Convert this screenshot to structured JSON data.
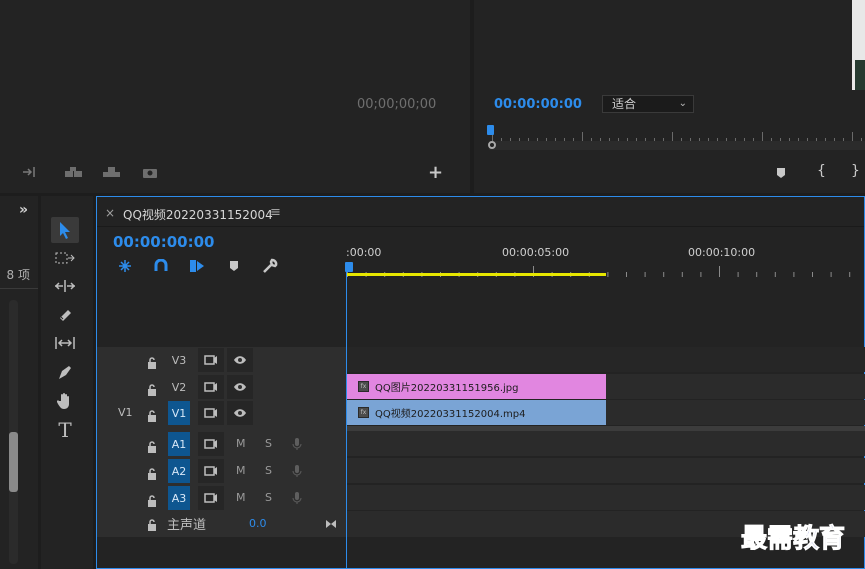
{
  "source_monitor": {
    "timecode": "00;00;00;00",
    "add_icon": "+"
  },
  "program_monitor": {
    "timecode": "00:00:00:00",
    "fit_label": "适合",
    "brace_left": "{",
    "brace_right": "}"
  },
  "project_panel": {
    "items_label": "8 项",
    "expand_icon": "»"
  },
  "timeline": {
    "close": "×",
    "sequence_name": "QQ视频20220331152004",
    "menu": "≡",
    "timecode": "00:00:00:00",
    "ruler": [
      ":00:00",
      "00:00:05:00",
      "00:00:10:00"
    ],
    "tracks": {
      "video": [
        {
          "label": "V3",
          "source": ""
        },
        {
          "label": "V2",
          "source": ""
        },
        {
          "label": "V1",
          "source": "V1"
        }
      ],
      "audio": [
        {
          "label": "A1",
          "m": "M",
          "s": "S"
        },
        {
          "label": "A2",
          "m": "M",
          "s": "S"
        },
        {
          "label": "A3",
          "m": "M",
          "s": "S"
        }
      ],
      "master_label": "主声道",
      "master_value": "0.0"
    },
    "clips": [
      {
        "name": "QQ图片20220331151956.jpg",
        "color": "#e186e0"
      },
      {
        "name": "QQ视频20220331152004.mp4",
        "color": "#7aa4d5"
      }
    ]
  },
  "tools_panel": {
    "type_tool": "T"
  },
  "watermark": "最需教育",
  "colors": {
    "accent": "#2d8ceb",
    "work_area": "#e6e600",
    "track_on": "#0e5690"
  }
}
